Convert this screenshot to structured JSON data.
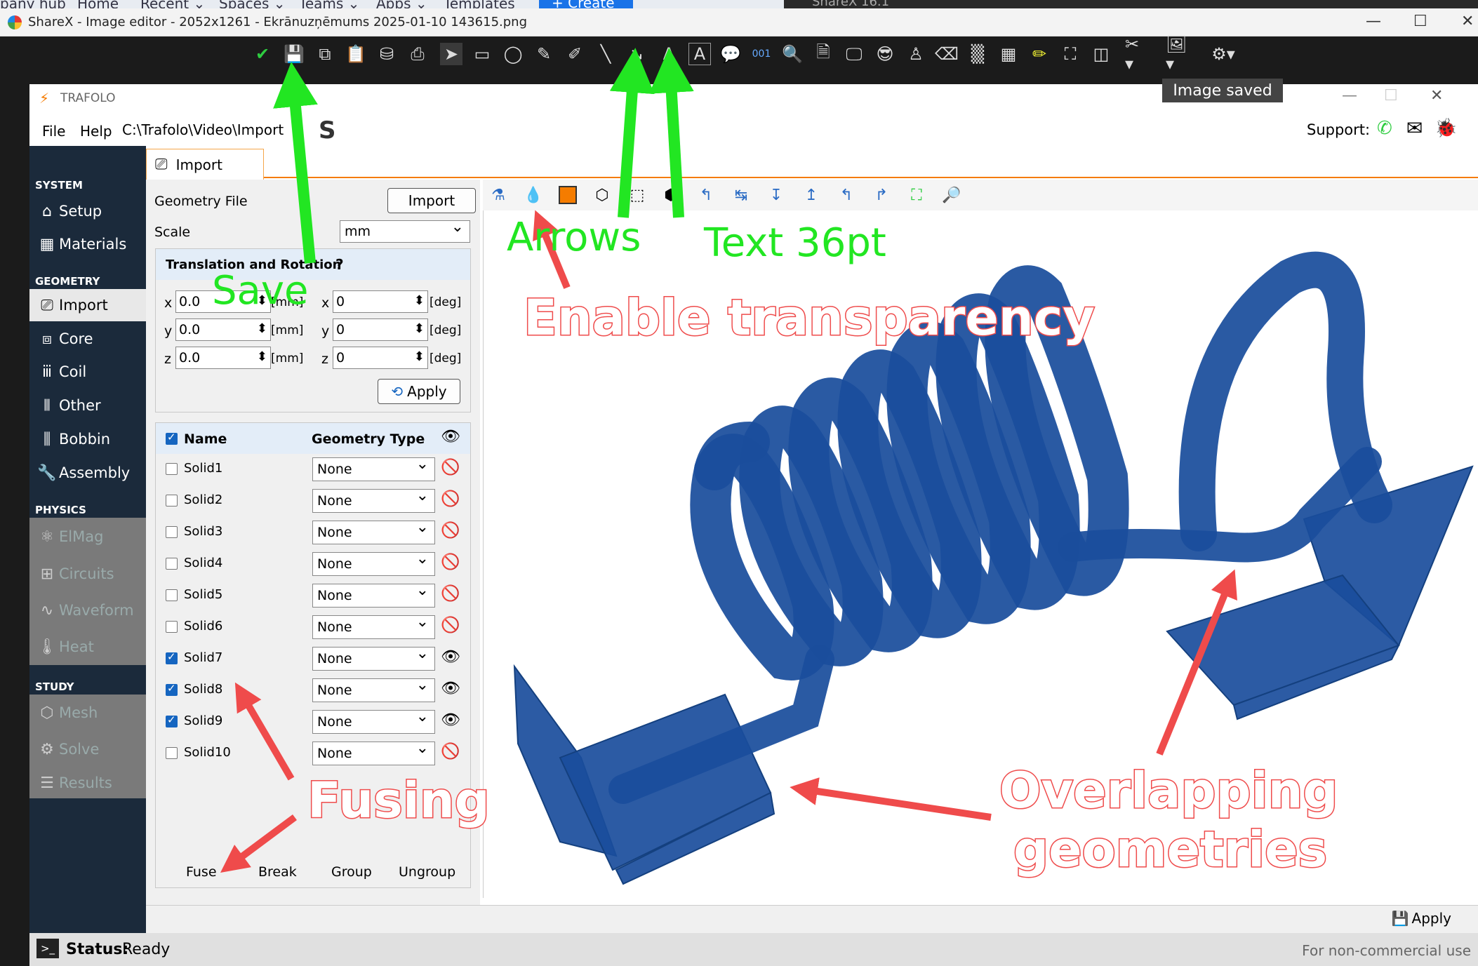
{
  "browser_strip": {
    "items": [
      "pany hub",
      "Home",
      "Recent ⌄",
      "Spaces ⌄",
      "Teams ⌄",
      "Apps ⌄",
      "Templates"
    ],
    "create": "+ Create",
    "right_app": "ShareX 16.1"
  },
  "sharex": {
    "title": "ShareX - Image editor - 2052x1261 - Ekrānuzņēmums 2025-01-10 143615.png",
    "toolbar_icons": [
      "check-icon",
      "save-icon",
      "save-as-icon",
      "clipboard-icon",
      "upload-icon",
      "print-icon",
      "cursor-icon",
      "rectangle-icon",
      "ellipse-icon",
      "freehand-icon",
      "freehand-arrow-icon",
      "line-icon",
      "arrow-icon",
      "text-outline-icon",
      "text-background-icon",
      "speech-balloon-icon",
      "step-icon",
      "magnify-icon",
      "image-file-icon",
      "image-screen-icon",
      "sticker-icon",
      "cursor-stamp-icon",
      "eraser-icon",
      "blur-icon",
      "pixelate-icon",
      "highlight-icon",
      "crop-icon",
      "cut-out-icon",
      "tools-icon",
      "image-options-icon",
      "settings-icon"
    ],
    "tooltip": "Image saved"
  },
  "trafolo": {
    "title": "TRAFOLO",
    "menu": [
      "File",
      "Help"
    ],
    "path": "C:\\Trafolo\\Video\\Import",
    "support_label": "Support:",
    "sidebar": {
      "sections": [
        {
          "title": "SYSTEM",
          "items": [
            {
              "label": "Setup",
              "icon": "home-icon"
            },
            {
              "label": "Materials",
              "icon": "materials-icon"
            }
          ]
        },
        {
          "title": "GEOMETRY",
          "items": [
            {
              "label": "Import",
              "icon": "import-icon"
            },
            {
              "label": "Core",
              "icon": "core-icon"
            },
            {
              "label": "Coil",
              "icon": "coil-icon"
            },
            {
              "label": "Other",
              "icon": "other-icon"
            },
            {
              "label": "Bobbin",
              "icon": "bobbin-icon"
            },
            {
              "label": "Assembly",
              "icon": "wrench-icon"
            }
          ]
        },
        {
          "title": "PHYSICS",
          "items": [
            {
              "label": "ElMag",
              "icon": "atom-icon"
            },
            {
              "label": "Circuits",
              "icon": "circuit-icon"
            },
            {
              "label": "Waveform",
              "icon": "wave-icon"
            },
            {
              "label": "Heat",
              "icon": "thermometer-icon"
            }
          ]
        },
        {
          "title": "STUDY",
          "items": [
            {
              "label": "Mesh",
              "icon": "mesh-icon"
            },
            {
              "label": "Solve",
              "icon": "solve-icon"
            },
            {
              "label": "Results",
              "icon": "results-icon"
            }
          ]
        }
      ]
    },
    "tab": "Import",
    "geometry_file_label": "Geometry File",
    "import_button": "Import",
    "scale_label": "Scale",
    "scale_value": "mm",
    "tr_header": "Translation and Rotation",
    "tr_help": "?",
    "translation": [
      {
        "axis": "x",
        "value": "0.0",
        "unit": "[mm]"
      },
      {
        "axis": "y",
        "value": "0.0",
        "unit": "[mm]"
      },
      {
        "axis": "z",
        "value": "0.0",
        "unit": "[mm]"
      }
    ],
    "rotation": [
      {
        "axis": "x",
        "value": "0",
        "unit": "[deg]"
      },
      {
        "axis": "y",
        "value": "0",
        "unit": "[deg]"
      },
      {
        "axis": "z",
        "value": "0",
        "unit": "[deg]"
      }
    ],
    "apply_label": "Apply",
    "table": {
      "headers": [
        "Name",
        "Geometry Type"
      ],
      "rows": [
        {
          "name": "Solid1",
          "type": "None",
          "checked": false,
          "visible": false
        },
        {
          "name": "Solid2",
          "type": "None",
          "checked": false,
          "visible": false
        },
        {
          "name": "Solid3",
          "type": "None",
          "checked": false,
          "visible": false
        },
        {
          "name": "Solid4",
          "type": "None",
          "checked": false,
          "visible": false
        },
        {
          "name": "Solid5",
          "type": "None",
          "checked": false,
          "visible": false
        },
        {
          "name": "Solid6",
          "type": "None",
          "checked": false,
          "visible": false
        },
        {
          "name": "Solid7",
          "type": "None",
          "checked": true,
          "visible": true
        },
        {
          "name": "Solid8",
          "type": "None",
          "checked": true,
          "visible": true
        },
        {
          "name": "Solid9",
          "type": "None",
          "checked": true,
          "visible": true
        },
        {
          "name": "Solid10",
          "type": "None",
          "checked": false,
          "visible": false
        }
      ]
    },
    "actions": [
      "Fuse",
      "Break",
      "Group",
      "Ungroup"
    ],
    "viewport_tools": [
      "axes-icon",
      "transparency-icon",
      "solid-color-icon",
      "wireframe-icon",
      "select-icon",
      "cube-icon",
      "view-x-icon",
      "view-neg-x-icon",
      "view-neg-y-icon",
      "view-y-icon",
      "view-neg-z-icon",
      "view-z-icon",
      "fit-icon",
      "zoom-icon"
    ],
    "bottom_apply": "Apply",
    "status_label": "Status:",
    "status_value": "Ready",
    "license": "For non-commercial use"
  },
  "annotations": {
    "green": [
      "Save",
      "Arrows",
      "Text 36pt"
    ],
    "red": [
      "Enable transparency",
      "Fusing",
      "Overlapping",
      "geometries"
    ]
  },
  "colors": {
    "sidebar": "#1b2a3b",
    "accent": "#f57c00",
    "model": "#1a4d9c",
    "green": "#22e622",
    "red": "#ef4b4b"
  }
}
